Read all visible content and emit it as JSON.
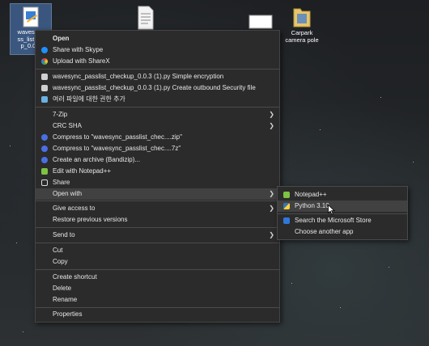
{
  "desktop": {
    "icons": [
      {
        "label": "wavesync_passlist_check_p_0.0.3",
        "icon": "python-file-icon",
        "selected": true
      },
      {
        "label": "",
        "icon": "text-document-icon",
        "selected": false
      },
      {
        "label": "",
        "icon": "blank-document-icon",
        "selected": false
      },
      {
        "label": "Carpark camera pole",
        "icon": "folder-icon",
        "selected": false
      }
    ],
    "icon1_lines": [
      "wavesync",
      "ss_list_ch",
      "p_0.0.3"
    ],
    "icon4_lines": [
      "Carpark",
      "camera pole"
    ]
  },
  "context_menu": {
    "items": [
      {
        "label": "Open",
        "icon": "",
        "bold": true
      },
      {
        "label": "Share with Skype",
        "icon": "skype-icon"
      },
      {
        "label": "Upload with ShareX",
        "icon": "sharex-icon"
      },
      {
        "label": "wavesync_passlist_checkup_0.0.3 (1).py Simple encryption",
        "icon": "script-icon"
      },
      {
        "label": "wavesync_passlist_checkup_0.0.3 (1).py Create outbound Security file",
        "icon": "script-icon"
      },
      {
        "label": "여러 파일에 대한 권한 추가",
        "icon": "permissions-icon"
      },
      {
        "label": "7-Zip",
        "icon": "",
        "submenu": true
      },
      {
        "label": "CRC SHA",
        "icon": "",
        "submenu": true
      },
      {
        "label": "Compress to \"wavesync_passlist_chec....zip\"",
        "icon": "bandizip-icon"
      },
      {
        "label": "Compress to \"wavesync_passlist_chec....7z\"",
        "icon": "bandizip-icon"
      },
      {
        "label": "Create an archive (Bandizip)...",
        "icon": "bandizip-icon"
      },
      {
        "label": "Edit with Notepad++",
        "icon": "notepadpp-icon"
      },
      {
        "label": "Share",
        "icon": "share-icon"
      },
      {
        "label": "Open with",
        "icon": "",
        "submenu": true,
        "highlighted": true
      },
      {
        "label": "Give access to",
        "icon": "",
        "submenu": true
      },
      {
        "label": "Restore previous versions",
        "icon": ""
      },
      {
        "label": "Send to",
        "icon": "",
        "submenu": true
      },
      {
        "label": "Cut",
        "icon": ""
      },
      {
        "label": "Copy",
        "icon": ""
      },
      {
        "label": "Create shortcut",
        "icon": ""
      },
      {
        "label": "Delete",
        "icon": ""
      },
      {
        "label": "Rename",
        "icon": ""
      },
      {
        "label": "Properties",
        "icon": ""
      }
    ]
  },
  "open_with_submenu": {
    "items": [
      {
        "label": "Notepad++",
        "icon": "notepadpp-icon"
      },
      {
        "label": "Python 3.10",
        "icon": "python-icon",
        "highlighted": true
      },
      {
        "label": "Search the Microsoft Store",
        "icon": "store-icon"
      },
      {
        "label": "Choose another app",
        "icon": ""
      }
    ]
  },
  "colors": {
    "menu_bg": "#2b2b2b",
    "hover_bg": "#414141",
    "text": "#e8e8e8"
  }
}
